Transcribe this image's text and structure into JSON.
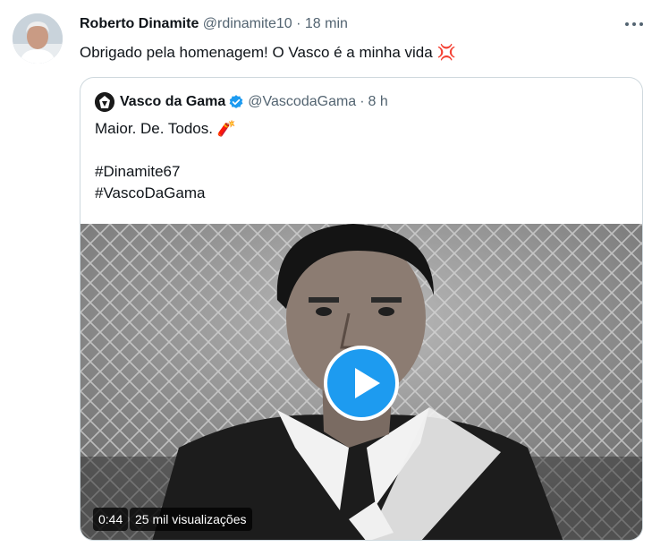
{
  "tweet": {
    "author_name": "Roberto Dinamite",
    "handle": "@rdinamite10",
    "separator": "·",
    "time": "18 min",
    "text": "Obrigado pela homenagem! O Vasco é a minha vida",
    "emoji": "💢"
  },
  "quoted": {
    "author_name": "Vasco da Gama",
    "handle": "@VascodaGama",
    "separator": "·",
    "time": "8 h",
    "text": "Maior. De. Todos. 🧨\n\n#Dinamite67\n#VascoDaGama",
    "video": {
      "duration": "0:44",
      "views": "25 mil visualizações"
    }
  },
  "colors": {
    "accent": "#1d9bf0",
    "muted": "#536471",
    "border": "#cfd9de"
  },
  "icons": [
    "more-icon",
    "verified-icon",
    "play-icon"
  ]
}
